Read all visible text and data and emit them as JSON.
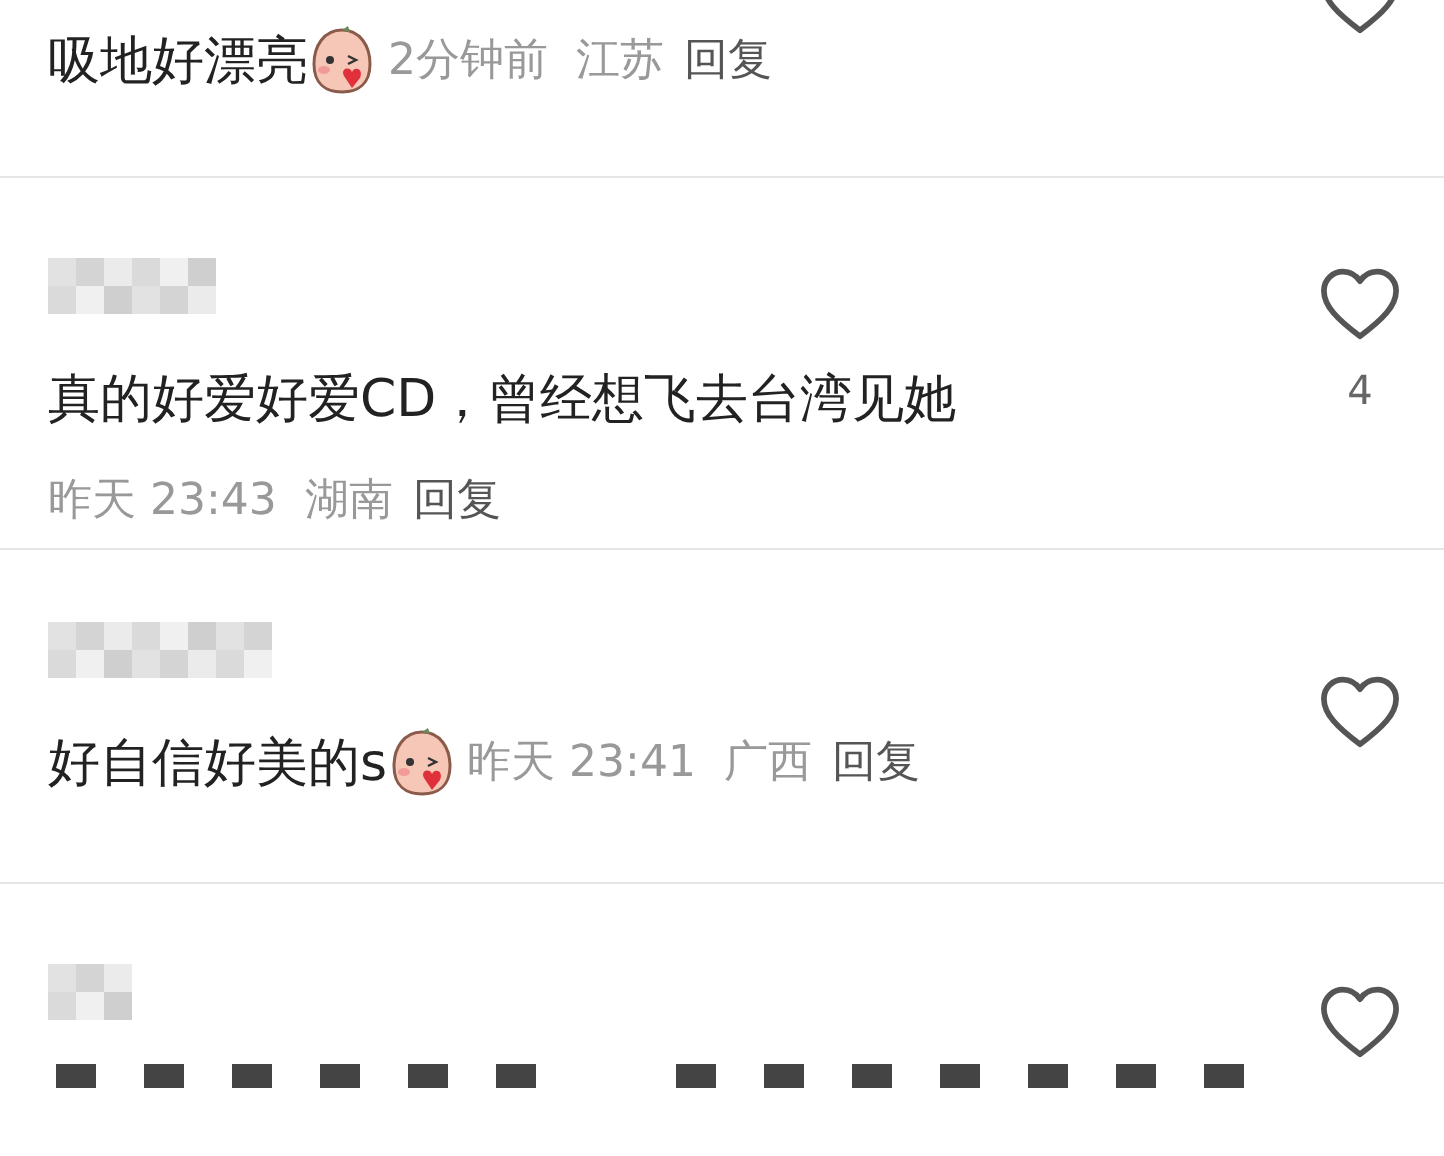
{
  "comments": [
    {
      "kind": "inline",
      "name_blurred": false,
      "text": "吸地好漂亮",
      "sticker": true,
      "time": "2分钟前",
      "location": "江苏",
      "reply": "回复"
    },
    {
      "kind": "stacked",
      "name_blurred": true,
      "text": "真的好爱好爱CD，曾经想飞去台湾见她",
      "sticker": false,
      "time": "昨天 23:43",
      "location": "湖南",
      "reply": "回复",
      "likes": "4"
    },
    {
      "kind": "inline",
      "name_blurred": true,
      "text": "好自信好美的s",
      "sticker": true,
      "time": "昨天 23:41",
      "location": "广西",
      "reply": "回复"
    },
    {
      "kind": "partial",
      "name_blurred": true
    }
  ]
}
